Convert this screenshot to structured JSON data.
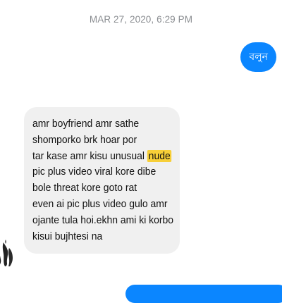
{
  "conversation": {
    "timestamp": "MAR 27, 2020, 6:29 PM",
    "sent_message": {
      "text": "বলুন"
    },
    "received_message": {
      "lines": [
        {
          "before": "amr boyfriend amr sathe"
        },
        {
          "before": "shomporko brk hoar por"
        },
        {
          "before": "tar kase amr kisu unusual ",
          "highlight": "nude"
        },
        {
          "before": "pic plus video viral kore dibe"
        },
        {
          "before": "bole threat kore goto rat"
        },
        {
          "before": "even ai pic plus video gulo amr"
        },
        {
          "before": "ojante tula hoi.ekhn ami ki korbo"
        },
        {
          "before": "kisui bujhtesi na"
        }
      ]
    }
  },
  "colors": {
    "sent_bubble": "#0b86ff",
    "received_bubble": "#f0f0f0",
    "highlight": "#f7cf38",
    "timestamp": "#8a8d91"
  },
  "icons": {
    "avatar": "user-avatar-icon"
  }
}
